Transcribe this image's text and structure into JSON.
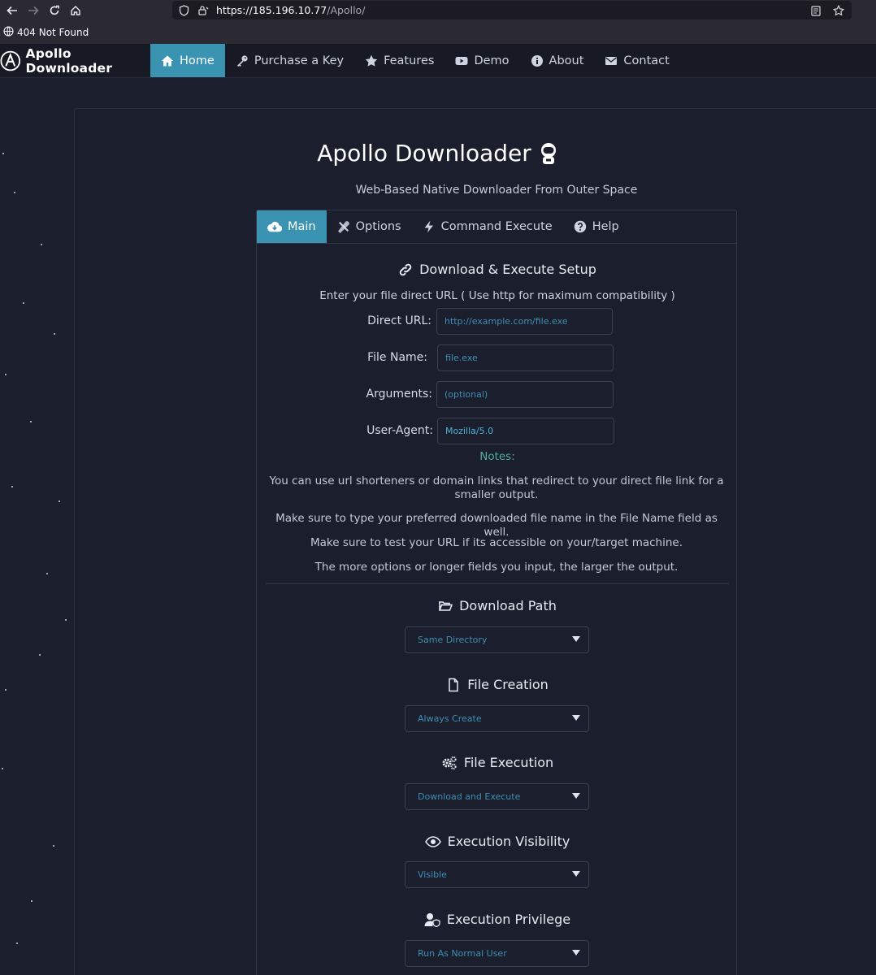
{
  "browser": {
    "url_host": "https://185.196.10.77",
    "url_path": "/Apollo/",
    "status_text": "404 Not Found"
  },
  "nav": {
    "brand": "Apollo Downloader",
    "items": [
      {
        "label": "Home",
        "icon": "home-icon"
      },
      {
        "label": "Purchase a Key",
        "icon": "key-icon"
      },
      {
        "label": "Features",
        "icon": "star-icon"
      },
      {
        "label": "Demo",
        "icon": "youtube-icon"
      },
      {
        "label": "About",
        "icon": "info-icon"
      },
      {
        "label": "Contact",
        "icon": "envelope-icon"
      }
    ]
  },
  "header": {
    "title": "Apollo Downloader",
    "subtitle": "Web-Based Native Downloader From Outer Space"
  },
  "tabs": [
    {
      "label": "Main",
      "icon": "cloud-download-icon"
    },
    {
      "label": "Options",
      "icon": "tools-icon"
    },
    {
      "label": "Command Execute",
      "icon": "bolt-icon"
    },
    {
      "label": "Help",
      "icon": "question-icon"
    }
  ],
  "setup": {
    "heading": "Download & Execute Setup",
    "instruction": "Enter your file direct URL ( Use http for maximum compatibility )",
    "fields": {
      "direct_url": {
        "label": "Direct URL:",
        "placeholder": "http://example.com/file.exe"
      },
      "file_name": {
        "label": "File Name:",
        "placeholder": "file.exe"
      },
      "arguments": {
        "label": "Arguments:",
        "placeholder": "(optional)"
      },
      "user_agent": {
        "label": "User-Agent:",
        "value": "Mozilla/5.0"
      }
    },
    "notes_title": "Notes:",
    "notes": [
      "You can use url shorteners or domain links that redirect to your direct file link for a smaller output.",
      "Make sure to type your preferred downloaded file name in the File Name field as well.",
      "Make sure to test your URL if its accessible on your/target machine.",
      "The more options or longer fields you input, the larger the output."
    ]
  },
  "sections": [
    {
      "heading": "Download Path",
      "icon": "folder-open-icon",
      "value": "Same Directory"
    },
    {
      "heading": "File Creation",
      "icon": "file-icon",
      "value": "Always Create"
    },
    {
      "heading": "File Execution",
      "icon": "cogs-icon",
      "value": "Download and Execute"
    },
    {
      "heading": "Execution Visibility",
      "icon": "eye-icon",
      "value": "Visible"
    },
    {
      "heading": "Execution Privilege",
      "icon": "user-shield-icon",
      "value": "Run As Normal User"
    }
  ]
}
